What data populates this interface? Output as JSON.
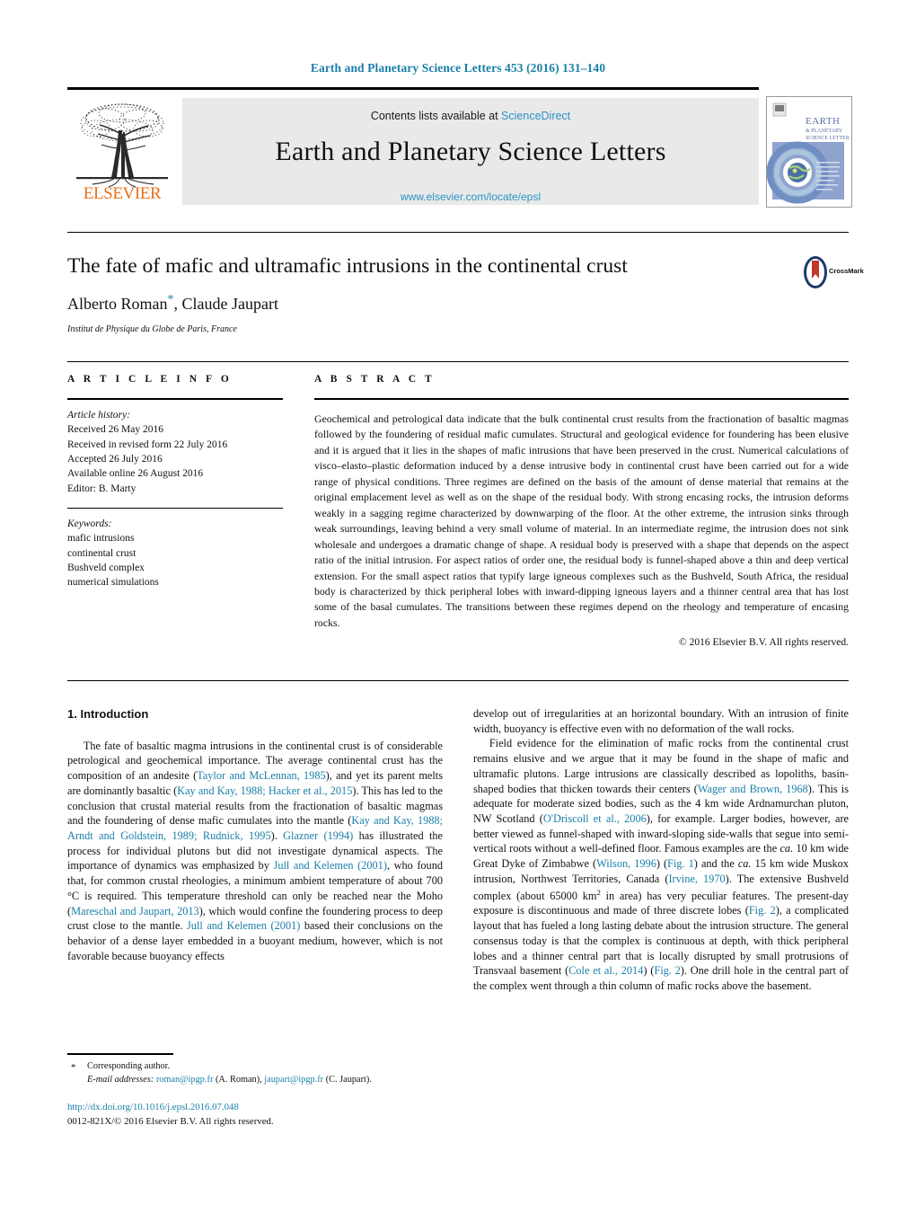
{
  "running_head": "Earth and Planetary Science Letters 453 (2016) 131–140",
  "masthead": {
    "contents_prefix": "Contents lists available at ",
    "sciencedirect": "ScienceDirect",
    "journal_title": "Earth and Planetary Science Letters",
    "journal_url": "www.elsevier.com/locate/epsl",
    "publisher": "ELSEVIER",
    "cover_title_line1": "EARTH",
    "cover_title_line2": "& PLANETARY",
    "cover_title_line3": "SCIENCE LETTERS"
  },
  "article": {
    "title": "The fate of mafic and ultramafic intrusions in the continental crust",
    "authors_html": "Alberto Roman<span class=\"star\">*</span>, Claude Jaupart",
    "affiliation": "Institut de Physique du Globe de Paris, France",
    "crossmark_label": "CrossMark"
  },
  "info": {
    "heading": "A R T I C L E    I N F O",
    "history_title": "Article history:",
    "history_lines": [
      "Received 26 May 2016",
      "Received in revised form 22 July 2016",
      "Accepted 26 July 2016",
      "Available online 26 August 2016",
      "Editor: B. Marty"
    ],
    "keywords_title": "Keywords:",
    "keywords": [
      "mafic intrusions",
      "continental crust",
      "Bushveld complex",
      "numerical simulations"
    ]
  },
  "abstract": {
    "heading": "A B S T R A C T",
    "text": "Geochemical and petrological data indicate that the bulk continental crust results from the fractionation of basaltic magmas followed by the foundering of residual mafic cumulates. Structural and geological evidence for foundering has been elusive and it is argued that it lies in the shapes of mafic intrusions that have been preserved in the crust. Numerical calculations of visco–elasto–plastic deformation induced by a dense intrusive body in continental crust have been carried out for a wide range of physical conditions. Three regimes are defined on the basis of the amount of dense material that remains at the original emplacement level as well as on the shape of the residual body. With strong encasing rocks, the intrusion deforms weakly in a sagging regime characterized by downwarping of the floor. At the other extreme, the intrusion sinks through weak surroundings, leaving behind a very small volume of material. In an intermediate regime, the intrusion does not sink wholesale and undergoes a dramatic change of shape. A residual body is preserved with a shape that depends on the aspect ratio of the initial intrusion. For aspect ratios of order one, the residual body is funnel-shaped above a thin and deep vertical extension. For the small aspect ratios that typify large igneous complexes such as the Bushveld, South Africa, the residual body is characterized by thick peripheral lobes with inward-dipping igneous layers and a thinner central area that has lost some of the basal cumulates. The transitions between these regimes depend on the rheology and temperature of encasing rocks.",
    "copyright": "© 2016 Elsevier B.V. All rights reserved."
  },
  "body": {
    "section_title": "1. Introduction",
    "left_paragraph_html": "The fate of basaltic magma intrusions in the continental crust is of considerable petrological and geochemical importance. The average continental crust has the composition of an andesite (<span class=\"ref\">Taylor and McLennan, 1985</span>), and yet its parent melts are dominantly basaltic (<span class=\"ref\">Kay and Kay, 1988; Hacker et al., 2015</span>). This has led to the conclusion that crustal material results from the fractionation of basaltic magmas and the foundering of dense mafic cumulates into the mantle (<span class=\"ref\">Kay and Kay, 1988; Arndt and Goldstein, 1989; Rudnick, 1995</span>). <span class=\"ref\">Glazner (1994)</span> has illustrated the process for individual plutons but did not investigate dynamical aspects. The importance of dynamics was emphasized by <span class=\"ref\">Jull and Kelemen (2001)</span>, who found that, for common crustal rheologies, a minimum ambient temperature of about 700 °C is required. This temperature threshold can only be reached near the Moho (<span class=\"ref\">Mareschal and Jaupart, 2013</span>), which would confine the foundering process to deep crust close to the mantle. <span class=\"ref\">Jull and Kelemen (2001)</span> based their conclusions on the behavior of a dense layer embedded in a buoyant medium, however, which is not favorable because buoyancy effects",
    "right_paragraph1_html": "develop out of irregularities at an horizontal boundary. With an intrusion of finite width, buoyancy is effective even with no deformation of the wall rocks.",
    "right_paragraph2_html": "Field evidence for the elimination of mafic rocks from the continental crust remains elusive and we argue that it may be found in the shape of mafic and ultramafic plutons. Large intrusions are classically described as lopoliths, basin-shaped bodies that thicken towards their centers (<span class=\"ref\">Wager and Brown, 1968</span>). This is adequate for moderate sized bodies, such as the 4 km wide Ardnamurchan pluton, NW Scotland (<span class=\"ref\">O'Driscoll et al., 2006</span>), for example. Larger bodies, however, are better viewed as funnel-shaped with inward-sloping side-walls that segue into semi-vertical roots without a well-defined floor. Famous examples are the <span class=\"ital\">ca.</span> 10 km wide Great Dyke of Zimbabwe (<span class=\"ref\">Wilson, 1996</span>) (<span class=\"ref\">Fig. 1</span>) and the <span class=\"ital\">ca.</span> 15 km wide Muskox intrusion, Northwest Territories, Canada (<span class=\"ref\">Irvine, 1970</span>). The extensive Bushveld complex (about 65000 km<sup>2</sup> in area) has very peculiar features. The present-day exposure is discontinuous and made of three discrete lobes (<span class=\"ref\">Fig. 2</span>), a complicated layout that has fueled a long lasting debate about the intrusion structure. The general consensus today is that the complex is continuous at depth, with thick peripheral lobes and a thinner central part that is locally disrupted by small protrusions of Transvaal basement (<span class=\"ref\">Cole et al., 2014</span>) (<span class=\"ref\">Fig. 2</span>). One drill hole in the central part of the complex went through a thin column of mafic rocks above the basement."
  },
  "footnote": {
    "corresponding": "Corresponding author.",
    "email_label": "E-mail addresses:",
    "email1": "roman@ipgp.fr",
    "email1_name": "(A. Roman),",
    "email2": "jaupart@ipgp.fr",
    "email2_name": "(C. Jaupart)."
  },
  "doi": {
    "url": "http://dx.doi.org/10.1016/j.epsl.2016.07.048",
    "issn_line": "0012-821X/© 2016 Elsevier B.V. All rights reserved."
  },
  "colors": {
    "link": "#1a7fa8",
    "sciencedirect": "#2a92c4",
    "elsevier_orange": "#E8711A",
    "band_gray": "#e9e9e9"
  }
}
